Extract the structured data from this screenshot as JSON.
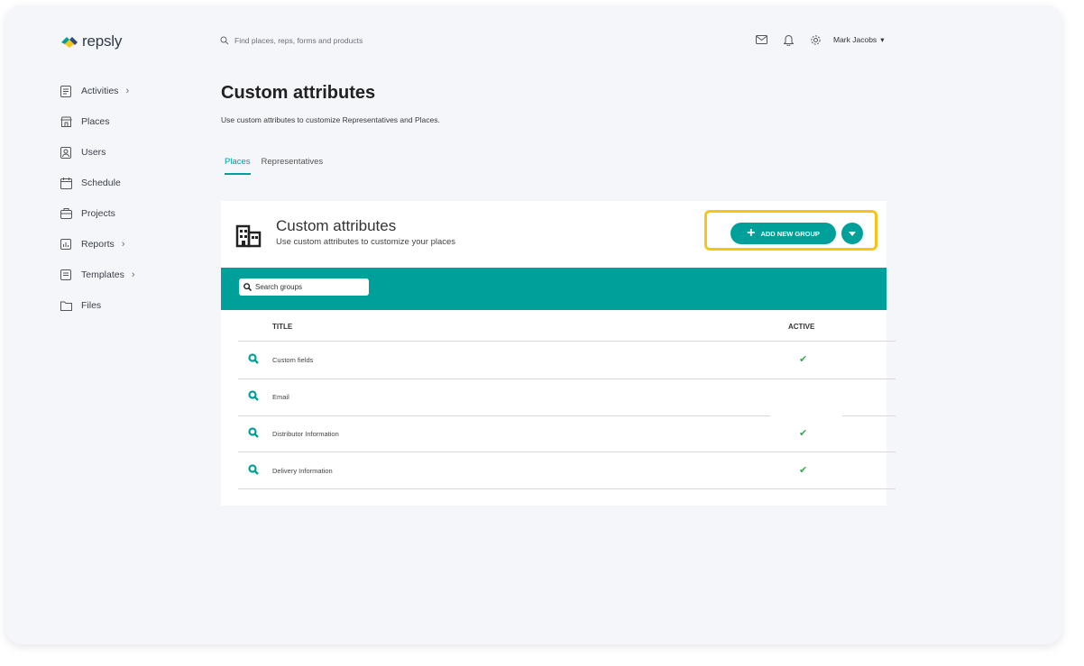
{
  "brand": {
    "name": "repsly",
    "accent": "#00a09a",
    "highlight": "#f5c518"
  },
  "search": {
    "placeholder": "Find places, reps, forms and products"
  },
  "topbar": {
    "user_name": "Mark Jacobs"
  },
  "sidebar": {
    "items": [
      {
        "label": "Activities",
        "icon": "clipboard-icon",
        "has_children": true
      },
      {
        "label": "Places",
        "icon": "store-icon",
        "has_children": false
      },
      {
        "label": "Users",
        "icon": "user-icon",
        "has_children": false
      },
      {
        "label": "Schedule",
        "icon": "calendar-icon",
        "has_children": false
      },
      {
        "label": "Projects",
        "icon": "briefcase-icon",
        "has_children": false
      },
      {
        "label": "Reports",
        "icon": "chart-icon",
        "has_children": true
      },
      {
        "label": "Templates",
        "icon": "template-icon",
        "has_children": true
      },
      {
        "label": "Files",
        "icon": "folder-icon",
        "has_children": false
      }
    ]
  },
  "page": {
    "title": "Custom attributes",
    "description": "Use custom attributes to customize Representatives and Places."
  },
  "tabs": [
    {
      "label": "Places",
      "active": true
    },
    {
      "label": "Representatives",
      "active": false
    }
  ],
  "card": {
    "title": "Custom attributes",
    "subtitle": "Use custom attributes to customize your places",
    "add_button": "ADD NEW GROUP",
    "search_placeholder": "Search groups",
    "columns": {
      "title": "TITLE",
      "active": "ACTIVE"
    },
    "rows": [
      {
        "name": "Custom fields",
        "active": true
      },
      {
        "name": "Email",
        "active": false
      },
      {
        "name": "Distributor Information",
        "active": true
      },
      {
        "name": "Delivery Information",
        "active": true
      }
    ]
  }
}
